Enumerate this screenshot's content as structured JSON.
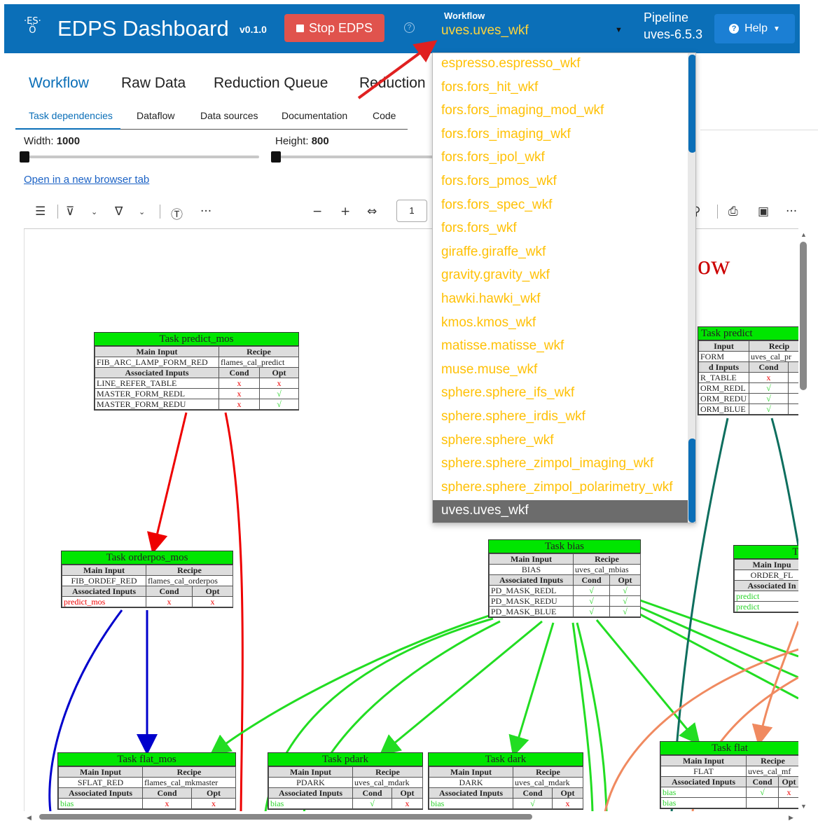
{
  "header": {
    "logo_text": "·ES·\n O",
    "title": "EDPS Dashboard",
    "version": "v0.1.0",
    "stop_label": "Stop EDPS",
    "workflow_label": "Workflow",
    "workflow_value": "uves.uves_wkf",
    "pipeline_label": "Pipeline",
    "pipeline_value": "uves-6.5.3",
    "help_label": "Help"
  },
  "main_tabs": [
    "Workflow",
    "Raw Data",
    "Reduction Queue",
    "Reduction"
  ],
  "sub_tabs": [
    "Task dependencies",
    "Dataflow",
    "Data sources",
    "Documentation",
    "Code"
  ],
  "controls": {
    "width_label": "Width:",
    "width_value": "1000",
    "height_label": "Height:",
    "height_value": "800",
    "width_level": 0,
    "height_level": 0,
    "open_link": "Open in a new browser tab"
  },
  "pdf_toolbar": {
    "page_number": "1"
  },
  "workflow_options": [
    "espresso.espresso_wkf",
    "fors.fors_hit_wkf",
    "fors.fors_imaging_mod_wkf",
    "fors.fors_imaging_wkf",
    "fors.fors_ipol_wkf",
    "fors.fors_pmos_wkf",
    "fors.fors_spec_wkf",
    "fors.fors_wkf",
    "giraffe.giraffe_wkf",
    "gravity.gravity_wkf",
    "hawki.hawki_wkf",
    "kmos.kmos_wkf",
    "matisse.matisse_wkf",
    "muse.muse_wkf",
    "sphere.sphere_ifs_wkf",
    "sphere.sphere_irdis_wkf",
    "sphere.sphere_wkf",
    "sphere.sphere_zimpol_imaging_wkf",
    "sphere.sphere_zimpol_polarimetry_wkf",
    "uves.uves_wkf"
  ],
  "graph": {
    "title_fragment": "ow",
    "col_main_input": "Main Input",
    "col_recipe": "Recipe",
    "col_assoc": "Associated Inputs",
    "col_cond": "Cond",
    "col_opt": "Opt",
    "x_mark": "x",
    "check_mark": "√",
    "tasks": {
      "predict_mos": {
        "title": "Task predict_mos",
        "main_input": "FIB_ARC_LAMP_FORM_RED",
        "recipe": "flames_cal_predict",
        "assoc": [
          "LINE_REFER_TABLE",
          "MASTER_FORM_REDL",
          "MASTER_FORM_REDU"
        ]
      },
      "orderpos_mos": {
        "title": "Task orderpos_mos",
        "main_input": "FIB_ORDEF_RED",
        "recipe": "flames_cal_orderpos",
        "assoc": [
          "predict_mos"
        ]
      },
      "bias": {
        "title": "Task bias",
        "main_input": "BIAS",
        "recipe": "uves_cal_mbias",
        "assoc": [
          "PD_MASK_REDL",
          "PD_MASK_REDU",
          "PD_MASK_BLUE"
        ]
      },
      "predict": {
        "title": "Task predict",
        "main_input": "Input",
        "main_input_value": "FORM",
        "recipe": "Recip",
        "recipe_value": "uves_cal_pr",
        "assoc_label": "d Inputs",
        "assoc": [
          "R_TABLE",
          "ORM_REDL",
          "ORM_REDU",
          "ORM_BLUE"
        ]
      },
      "orderpos": {
        "title": "Tas",
        "main_input": "Main Inpu",
        "main_input_value": "ORDER_FL",
        "assoc_label": "Associated In",
        "assoc": [
          "predict",
          "predict"
        ]
      },
      "flat_mos": {
        "title": "Task flat_mos",
        "main_input": "SFLAT_RED",
        "recipe": "flames_cal_mkmaster",
        "assoc": [
          "bias"
        ]
      },
      "pdark": {
        "title": "Task pdark",
        "main_input": "PDARK",
        "recipe": "uves_cal_mdark",
        "assoc": [
          "bias"
        ]
      },
      "dark": {
        "title": "Task dark",
        "main_input": "DARK",
        "recipe": "uves_cal_mdark",
        "assoc": [
          "bias"
        ]
      },
      "flat": {
        "title": "Task flat",
        "main_input": "FLAT",
        "recipe": "uves_cal_mf",
        "assoc": [
          "bias",
          "bias"
        ]
      }
    }
  }
}
